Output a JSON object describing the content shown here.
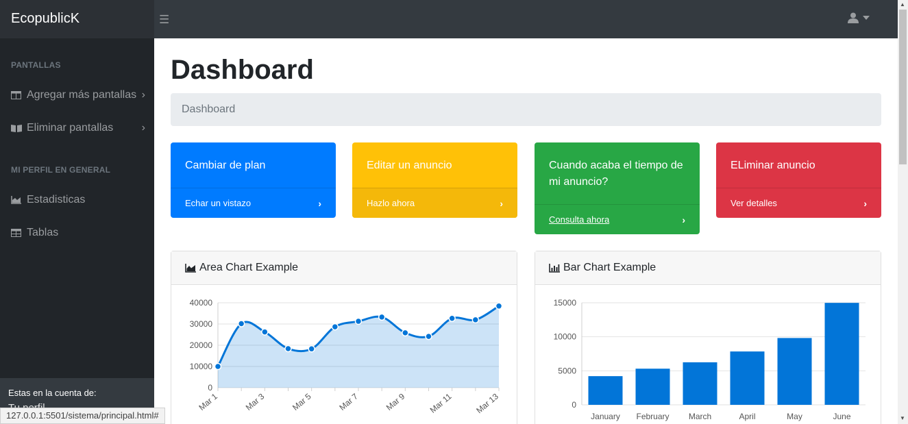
{
  "navbar": {
    "brand": "EcopublicK",
    "toggle_icon": "bars-icon",
    "user_icon": "user-icon"
  },
  "sidebar": {
    "section1": "PANTALLAS",
    "section2": "MI PERFIL EN GENERAL",
    "items": [
      {
        "label": "Agregar más pantallas",
        "icon": "columns-icon"
      },
      {
        "label": "Eliminar pantallas",
        "icon": "book-open-icon"
      },
      {
        "label": "Estadisticas",
        "icon": "area-chart-icon"
      },
      {
        "label": "Tablas",
        "icon": "table-icon"
      }
    ],
    "footer_label": "Estas en la cuenta de:",
    "footer_sub": "Tu perfil"
  },
  "page": {
    "title": "Dashboard",
    "breadcrumb": "Dashboard"
  },
  "cards": [
    {
      "title": "Cambiar de plan",
      "link": "Echar un vistazo",
      "color": "#007bff"
    },
    {
      "title": "Editar un anuncio",
      "link": "Hazlo ahora",
      "color": "#ffc107"
    },
    {
      "title": "Cuando acaba el tiempo de mi anuncio?",
      "link": "Consulta ahora",
      "color": "#28a745"
    },
    {
      "title": "ELiminar anuncio",
      "link": "Ver detalles",
      "color": "#dc3545"
    }
  ],
  "panels": {
    "area_title": "Area Chart Example",
    "bar_title": "Bar Chart Example"
  },
  "status_url": "127.0.0.1:5501/sistema/principal.html#",
  "chart_data": [
    {
      "type": "area",
      "title": "Area Chart Example",
      "x": [
        "Mar 1",
        "Mar 2",
        "Mar 3",
        "Mar 4",
        "Mar 5",
        "Mar 6",
        "Mar 7",
        "Mar 8",
        "Mar 9",
        "Mar 10",
        "Mar 11",
        "Mar 12",
        "Mar 13"
      ],
      "x_tick_labels": [
        "Mar 1",
        "Mar 3",
        "Mar 5",
        "Mar 7",
        "Mar 9",
        "Mar 11",
        "Mar 13"
      ],
      "values": [
        10000,
        30162,
        26263,
        18394,
        18287,
        28682,
        31274,
        33259,
        25849,
        24159,
        32651,
        31984,
        38451
      ],
      "ylim": [
        0,
        40000
      ],
      "y_ticks": [
        0,
        10000,
        20000,
        30000,
        40000
      ],
      "color": "#0275d8",
      "grid": true
    },
    {
      "type": "bar",
      "title": "Bar Chart Example",
      "categories": [
        "January",
        "February",
        "March",
        "April",
        "May",
        "June"
      ],
      "values": [
        4215,
        5312,
        6251,
        7841,
        9821,
        14984
      ],
      "ylim": [
        0,
        15000
      ],
      "y_ticks": [
        0,
        5000,
        10000,
        15000
      ],
      "color": "#0275d8",
      "grid": true
    }
  ]
}
